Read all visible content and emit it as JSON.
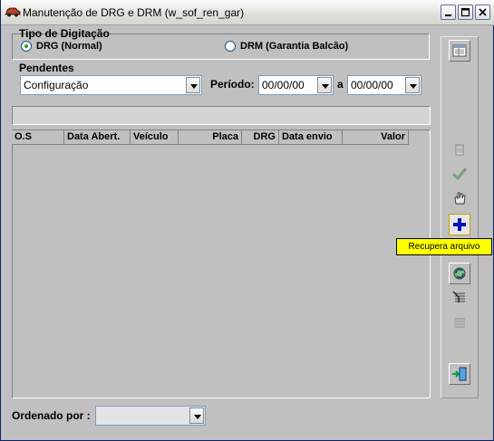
{
  "window": {
    "title": "Manutenção de DRG e DRM (w_sof_ren_gar)"
  },
  "tipo": {
    "label": "Tipo de Digitação",
    "options": [
      {
        "label": "DRG (Normal)",
        "selected": true
      },
      {
        "label": "DRM (Garantia Balcão)",
        "selected": false
      }
    ]
  },
  "pendentes": {
    "label": "Pendentes",
    "value": "Configuração"
  },
  "periodo": {
    "label": "Período:",
    "from": "00/00/00",
    "separator": "a",
    "to": "00/00/00"
  },
  "grid": {
    "columns": [
      "O.S",
      "Data Abert.",
      "Veículo",
      "Placa",
      "DRG",
      "Data envio",
      "Valor"
    ]
  },
  "toolbar": {
    "tooltip": "Recupera arquivo",
    "icons": [
      "report-icon",
      "delete-icon",
      "confirm-icon",
      "hand-icon",
      "add-icon",
      "refresh-icon",
      "filter-icon",
      "list-icon",
      "exit-icon"
    ]
  },
  "ordenado": {
    "label": "Ordenado por :",
    "value": ""
  },
  "colors": {
    "accent_blue": "#0a246a",
    "tooltip": "#ffff00",
    "background": "#c0c0c0"
  }
}
